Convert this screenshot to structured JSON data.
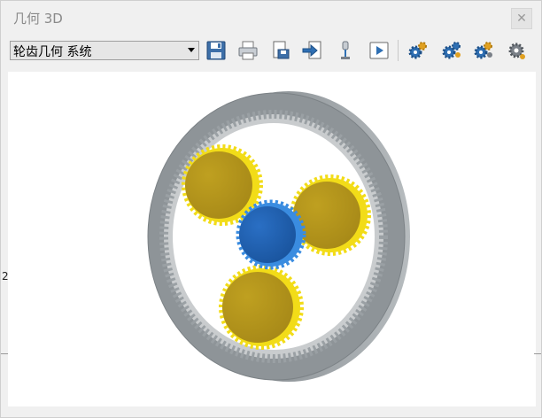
{
  "window": {
    "title": "几何 3D",
    "close_glyph": "✕"
  },
  "toolbar": {
    "combo_value": "轮齿几何  系统",
    "buttons": [
      {
        "name": "save-icon"
      },
      {
        "name": "print-icon"
      },
      {
        "name": "export-icon"
      },
      {
        "name": "import-icon"
      },
      {
        "name": "probe-icon"
      },
      {
        "name": "play-icon"
      },
      {
        "name": "gear-view-1-icon"
      },
      {
        "name": "gear-view-2-icon"
      },
      {
        "name": "gear-view-3-icon"
      },
      {
        "name": "gear-view-4-icon"
      }
    ]
  },
  "side_label": "2",
  "colors": {
    "ring": "#8e9498",
    "planet": "#c9a51a",
    "planet_edge": "#f2dc18",
    "sun": "#1f63b8",
    "sun_edge": "#3a8ce0"
  }
}
